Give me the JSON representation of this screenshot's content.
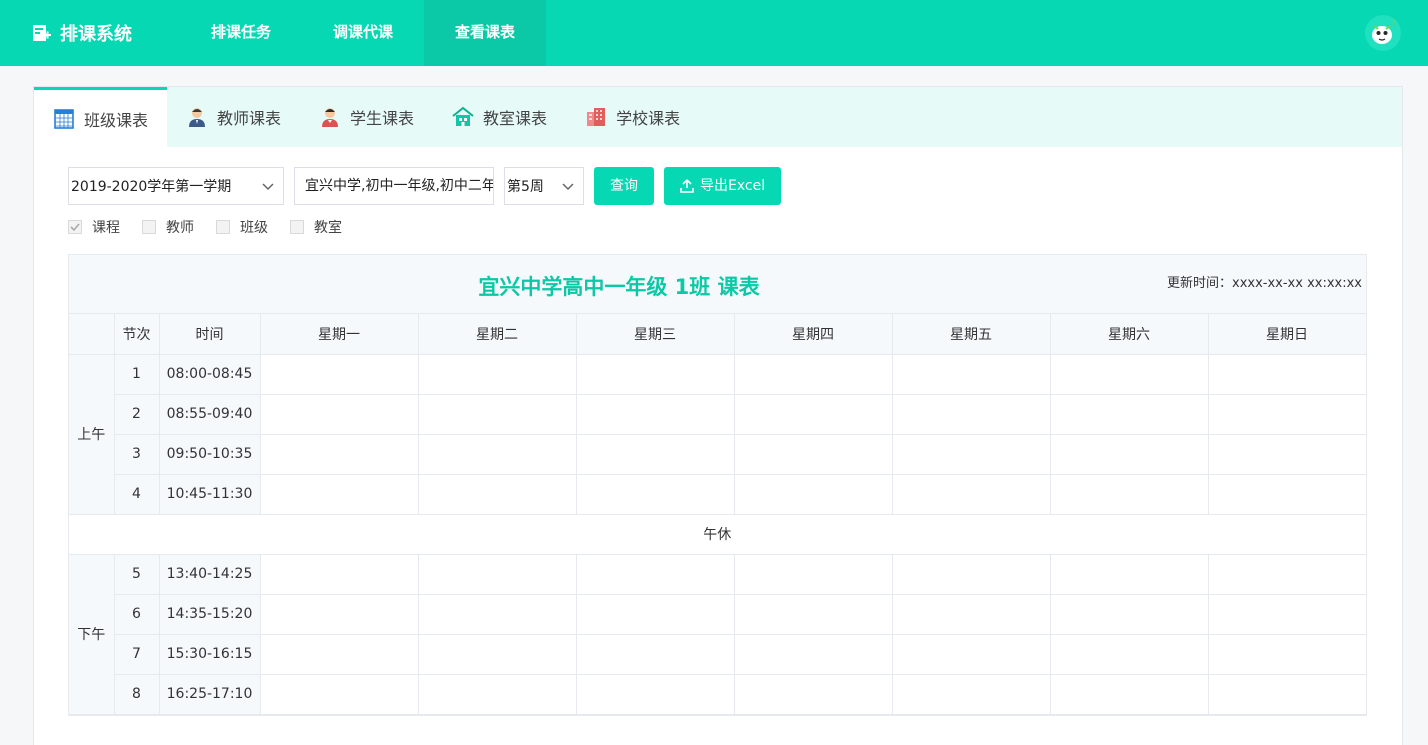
{
  "header": {
    "brand": "排课系统",
    "nav": [
      {
        "label": "排课任务",
        "active": false
      },
      {
        "label": "调课代课",
        "active": false
      },
      {
        "label": "查看课表",
        "active": true
      }
    ],
    "colors": {
      "primary": "#06d8b4",
      "active_nav": "#0bc9a6"
    }
  },
  "tabs": [
    {
      "label": "班级课表",
      "icon": "calendar-icon",
      "active": true
    },
    {
      "label": "教师课表",
      "icon": "teacher-icon",
      "active": false
    },
    {
      "label": "学生课表",
      "icon": "student-icon",
      "active": false
    },
    {
      "label": "教室课表",
      "icon": "classroom-icon",
      "active": false
    },
    {
      "label": "学校课表",
      "icon": "school-icon",
      "active": false
    }
  ],
  "filters": {
    "term": "2019-2020学年第一学期",
    "classes": "宜兴中学,初中一年级,初中二年",
    "week": "第5周",
    "query_label": "查询",
    "export_label": "导出Excel"
  },
  "checks": [
    {
      "label": "课程",
      "checked": true
    },
    {
      "label": "教师",
      "checked": false
    },
    {
      "label": "班级",
      "checked": false
    },
    {
      "label": "教室",
      "checked": false
    }
  ],
  "timetable": {
    "title": "宜兴中学高中一年级 1班 课表",
    "update_time": "更新时间：xxxx-xx-xx xx:xx:xx",
    "col_period": "节次",
    "col_time": "时间",
    "days": [
      "星期一",
      "星期二",
      "星期三",
      "星期四",
      "星期五",
      "星期六",
      "星期日"
    ],
    "morning_label": "上午",
    "afternoon_label": "下午",
    "break_label": "午休",
    "morning": [
      {
        "no": "1",
        "time": "08:00-08:45"
      },
      {
        "no": "2",
        "time": "08:55-09:40"
      },
      {
        "no": "3",
        "time": "09:50-10:35"
      },
      {
        "no": "4",
        "time": "10:45-11:30"
      }
    ],
    "afternoon": [
      {
        "no": "5",
        "time": "13:40-14:25"
      },
      {
        "no": "6",
        "time": "14:35-15:20"
      },
      {
        "no": "7",
        "time": "15:30-16:15"
      },
      {
        "no": "8",
        "time": "16:25-17:10"
      }
    ]
  }
}
